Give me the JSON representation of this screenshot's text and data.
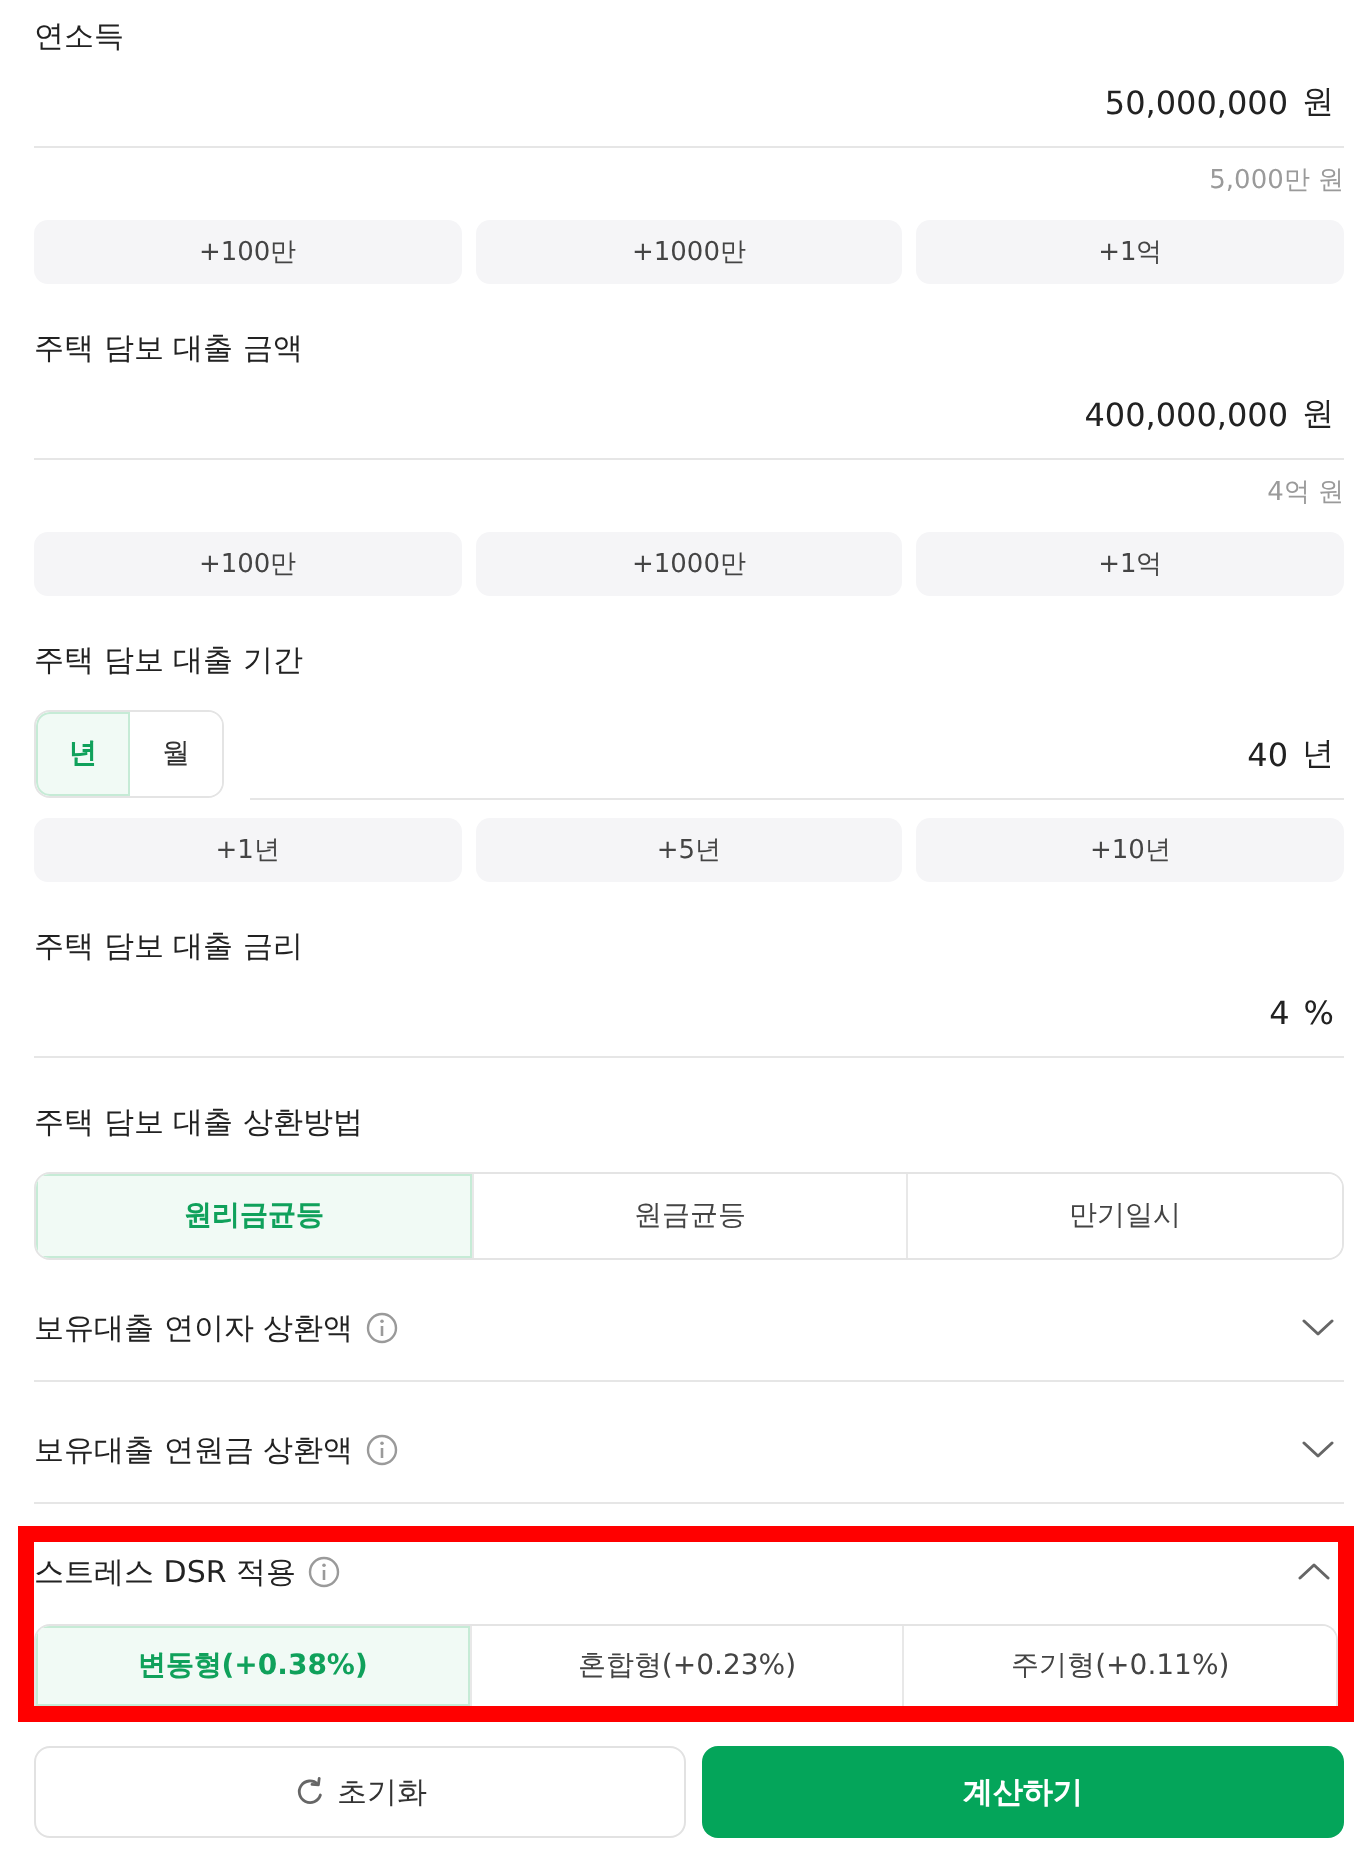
{
  "fields": [
    {
      "kind": "amount",
      "label": "연소득",
      "value": "50,000,000",
      "unit": "원",
      "hint": "5,000만 원",
      "quick_add": [
        "+100만",
        "+1000만",
        "+1억"
      ]
    },
    {
      "kind": "amount",
      "label": "주택 담보 대출 금액",
      "value": "400,000,000",
      "unit": "원",
      "hint": "4억 원",
      "quick_add": [
        "+100만",
        "+1000만",
        "+1억"
      ]
    },
    {
      "kind": "period",
      "label": "주택 담보 대출 기간",
      "unit_options": [
        {
          "label": "년",
          "selected": true
        },
        {
          "label": "월",
          "selected": false
        }
      ],
      "value": "40",
      "unit": "년",
      "quick_add": [
        "+1년",
        "+5년",
        "+10년"
      ]
    },
    {
      "kind": "rate",
      "label": "주택 담보 대출 금리",
      "value": "4",
      "unit": "%"
    },
    {
      "kind": "choice",
      "label": "주택 담보 대출 상환방법",
      "options": [
        {
          "label": "원리금균등",
          "selected": true
        },
        {
          "label": "원금균등",
          "selected": false
        },
        {
          "label": "만기일시",
          "selected": false
        }
      ]
    }
  ],
  "accordions": [
    {
      "label": "보유대출 연이자 상환액",
      "info": true,
      "expanded": false,
      "highlighted": false
    },
    {
      "label": "보유대출 연원금 상환액",
      "info": true,
      "expanded": false,
      "highlighted": false
    },
    {
      "label": "스트레스 DSR 적용",
      "info": true,
      "expanded": true,
      "highlighted": true,
      "options": [
        {
          "label": "변동형(+0.38%)",
          "selected": true
        },
        {
          "label": "혼합형(+0.23%)",
          "selected": false
        },
        {
          "label": "주기형(+0.11%)",
          "selected": false
        }
      ]
    }
  ],
  "actions": [
    {
      "kind": "reset",
      "label": "초기화"
    },
    {
      "kind": "submit",
      "label": "계산하기"
    }
  ]
}
